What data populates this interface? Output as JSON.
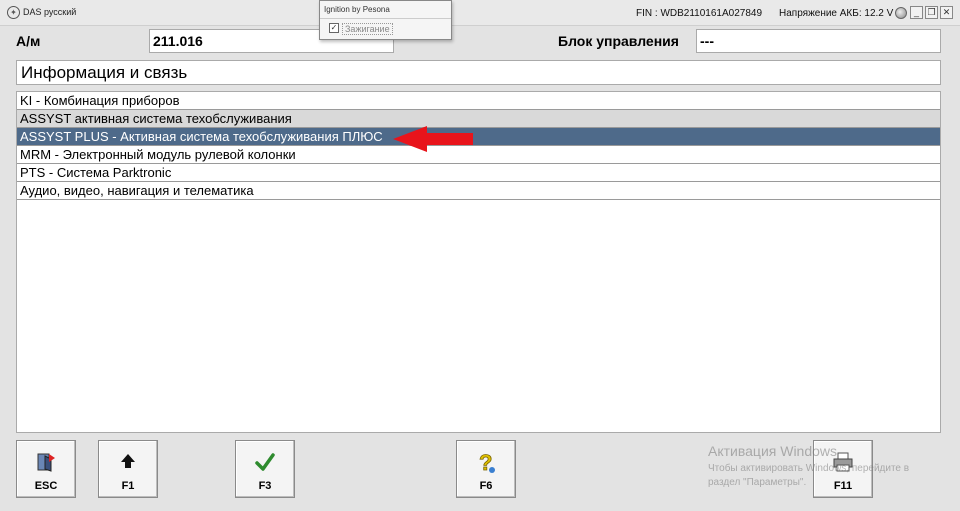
{
  "window": {
    "title": "DAS русский",
    "fin": "FIN : WDB2110161A027849",
    "voltage": "Напряжение АКБ: 12.2 V",
    "minimize": "_",
    "restore": "❐",
    "close": "✕"
  },
  "popup": {
    "title": "Ignition by Pesona",
    "checkbox_label": "Зажигание",
    "checked": "✓"
  },
  "header": {
    "am_label": "А/м",
    "am_value": "211.016",
    "ecu_label": "Блок управления",
    "ecu_value": "---"
  },
  "group": "Информация и связь",
  "list": {
    "items": [
      "KI - Комбинация приборов",
      "ASSYST активная система техобслуживания",
      "ASSYST PLUS - Активная система техобслуживания ПЛЮС",
      "MRM - Электронный модуль рулевой колонки",
      "PTS - Система Parktronic",
      "Аудио, видео, навигация и телематика"
    ],
    "selected_index": 2
  },
  "toolbar": {
    "esc": "ESC",
    "f1": "F1",
    "f3": "F3",
    "f6": "F6",
    "f11": "F11"
  },
  "watermark": {
    "title": "Активация Windows",
    "line1": "Чтобы активировать Windows, перейдите в",
    "line2": "раздел \"Параметры\"."
  },
  "colors": {
    "selected_row": "#4e6a8a",
    "arrow": "#e8141b",
    "check_green": "#2e8b2e"
  }
}
